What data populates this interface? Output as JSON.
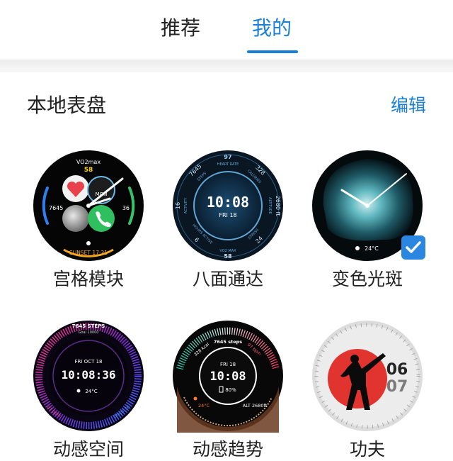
{
  "tabs": [
    {
      "label": "推荐",
      "active": false
    },
    {
      "label": "我的",
      "active": true
    }
  ],
  "section": {
    "title": "本地表盘",
    "edit_label": "编辑"
  },
  "faces": [
    {
      "name": "宫格模块",
      "selected": false,
      "texts": {
        "top_label": "VO2max",
        "top_value": "58",
        "left_value": "7645",
        "right_value": "36",
        "bottom_label": "SUNSET 17:31",
        "mid_label": "MON"
      }
    },
    {
      "name": "八面通达",
      "selected": false,
      "texts": {
        "time": "10:08",
        "date": "FRI 18",
        "top_value": "97",
        "top_label": "HEART RATE",
        "steps": "7645",
        "steps_label": "STEPS",
        "calories": "328",
        "calories_label": "CALORIES",
        "altitude": "2680 ft",
        "altitude_label": "ALTITUDE",
        "left_value": "16",
        "left_label": "ACTIVITY",
        "right_value": "24",
        "hours_value": "6",
        "hours_label": "HOURS ACTIVE",
        "bottom_value": "58",
        "bottom_label": "VO2 MAX",
        "stress_value": "24",
        "stress_label": "STRESS"
      }
    },
    {
      "name": "变色光斑",
      "selected": true,
      "texts": {
        "temp": "24°C"
      }
    },
    {
      "name": "动感空间",
      "selected": false,
      "texts": {
        "steps": "7645 STEPS",
        "goal": "Goal 10000",
        "date": "FRI OCT 18",
        "time": "10:08:36",
        "temp": "24°C",
        "left_arc": "97 bpm",
        "right_arc": "Steps 36"
      }
    },
    {
      "name": "动感趋势",
      "selected": false,
      "texts": {
        "kcal": "328 kcal",
        "steps": "7645 steps",
        "bpm": "97 bpm",
        "date": "FRI 18",
        "time": "10:08",
        "battery": "80%",
        "temp": "24°C",
        "alt": "ALT 2680ft"
      }
    },
    {
      "name": "功夫",
      "selected": false,
      "texts": {
        "hour": "06",
        "minute": "07"
      }
    }
  ],
  "icons": {
    "check": "checkmark-icon",
    "sun": "sun-icon",
    "battery": "battery-icon"
  },
  "colors": {
    "accent": "#1a7fd6",
    "badge": "#2a86e0",
    "text": "#222222"
  }
}
